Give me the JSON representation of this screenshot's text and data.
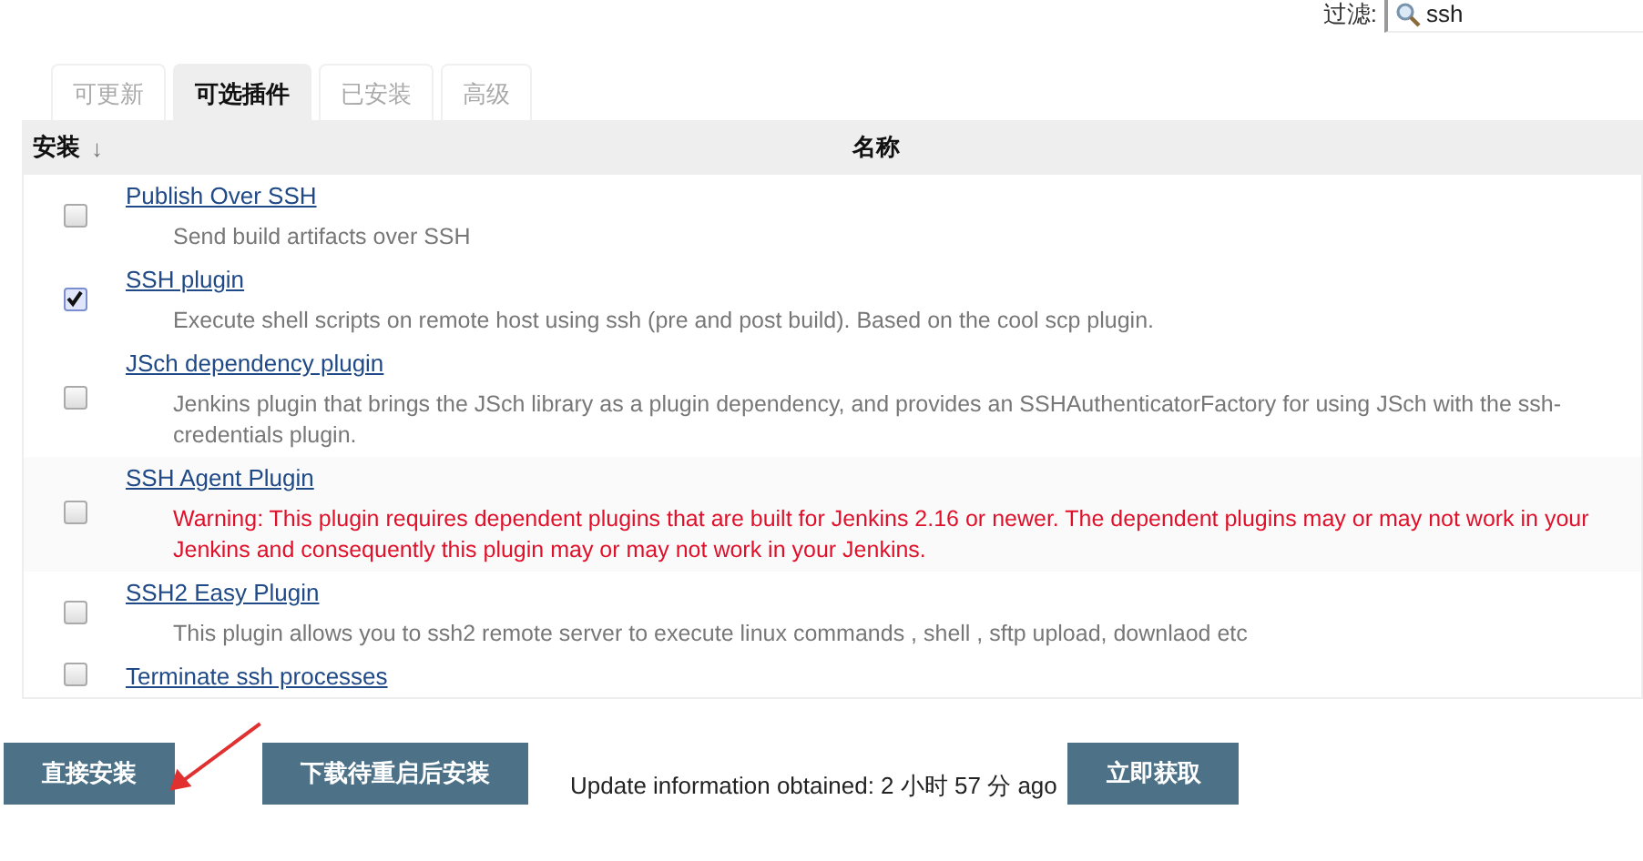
{
  "filter": {
    "label": "过滤:",
    "value": "ssh"
  },
  "tabs": [
    {
      "label": "可更新",
      "selected": false
    },
    {
      "label": "可选插件",
      "selected": true
    },
    {
      "label": "已安装",
      "selected": false
    },
    {
      "label": "高级",
      "selected": false
    }
  ],
  "table": {
    "columns": [
      {
        "label": "安装",
        "sort": "↓"
      },
      {
        "label": "名称"
      }
    ],
    "plugins": [
      {
        "name": "Publish Over SSH",
        "checked": false,
        "description": {
          "kind": "info",
          "lines": [
            "Send build artifacts over SSH"
          ]
        }
      },
      {
        "name": "SSH plugin",
        "checked": true,
        "description": {
          "kind": "info",
          "lines": [
            "Execute shell scripts on remote host using ssh (pre and post build). Based on the cool scp plugin."
          ]
        }
      },
      {
        "name": "JSch dependency plugin",
        "checked": false,
        "description": {
          "kind": "info",
          "lines": [
            "Jenkins plugin that brings the JSch library as a plugin dependency, and provides an SSHAuthenticatorFactory for using JSch with the ssh-",
            "credentials plugin."
          ]
        }
      },
      {
        "name": "SSH Agent Plugin",
        "checked": false,
        "description": {
          "kind": "warning",
          "lines": [
            "Warning: This plugin requires dependent plugins that are built for Jenkins 2.16 or newer. The dependent plugins may or may not work in your",
            "Jenkins and consequently this plugin may or may not work in your Jenkins."
          ]
        }
      },
      {
        "name": "SSH2 Easy Plugin",
        "checked": false,
        "description": {
          "kind": "info",
          "lines": [
            "This plugin allows you to ssh2 remote server to execute linux commands , shell , sftp upload, downlaod etc"
          ]
        }
      },
      {
        "name": "Terminate ssh processes",
        "checked": false
      }
    ]
  },
  "footer": {
    "install_button": "直接安装",
    "download_button": "下载待重启后安装",
    "update_info": "Update information obtained: 2 小时 57 分 ago",
    "refresh_button": "立即获取"
  }
}
